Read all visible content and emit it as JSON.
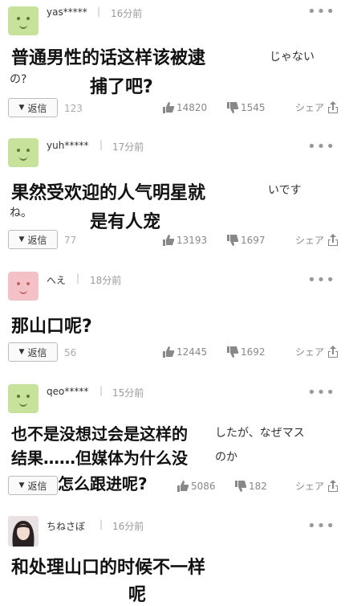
{
  "comments": [
    {
      "user": "yas*****",
      "time": "16分前",
      "zh_line1": "普通男性的话这样该被逮",
      "ja_line1": "じゃない",
      "ja_line2": "の?",
      "zh_line2": "捕了吧?",
      "reply_label": "返信",
      "reply_count": "123",
      "likes": "14820",
      "dislikes": "1545",
      "share": "シェア"
    },
    {
      "user": "yuh*****",
      "time": "17分前",
      "zh_line1": "果然受欢迎的人气明星就",
      "ja_line1": "いです",
      "ja_line2": "ね。",
      "zh_line2": "是有人宠",
      "reply_label": "返信",
      "reply_count": "77",
      "likes": "13193",
      "dislikes": "1697",
      "share": "シェア"
    },
    {
      "user": "へえ",
      "time": "18分前",
      "zh_line1": "那山口呢?",
      "reply_label": "返信",
      "reply_count": "56",
      "likes": "12445",
      "dislikes": "1692",
      "share": "シェア"
    },
    {
      "user": "qeo*****",
      "time": "15分前",
      "zh_line1": "也不是没想过会是这样的",
      "ja_line1": "したが、なぜマス",
      "zh_line2": "结果……但媒体为什么没",
      "ja_line2": "のか",
      "zh_line3": "怎么跟进呢?",
      "reply_label": "返信",
      "likes": "5086",
      "dislikes": "182",
      "share": "シェア"
    },
    {
      "user": "ちねさぼ",
      "time": "16分前",
      "zh_line1": "和处理山口的时候不一样",
      "zh_line2": "呢"
    }
  ],
  "icons": {
    "more": "more-dots-icon",
    "like": "thumbs-up-icon",
    "dislike": "thumbs-down-icon",
    "share": "share-icon"
  },
  "colors": {
    "avatar_green": "#c7e29a",
    "avatar_pink": "#f4c2c6"
  }
}
